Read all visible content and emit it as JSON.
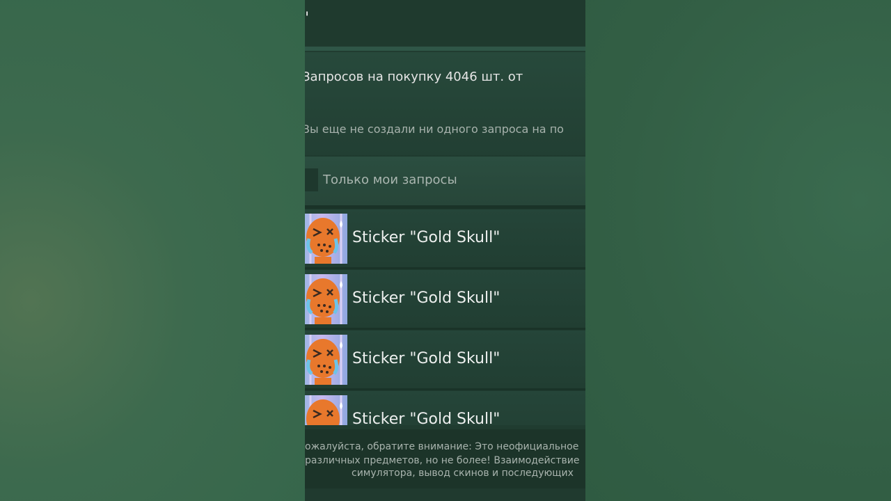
{
  "header": {
    "title": "\""
  },
  "requests": {
    "buy_text": "Запросов на покупку 4046 шт. от",
    "empty_text": "Вы еще не создали ни одного запроса на по"
  },
  "filter": {
    "label": "Только мои запросы",
    "checked": false
  },
  "items": [
    {
      "name": "Sticker \"Gold Skull\"",
      "icon": "sticker-crying-face-icon"
    },
    {
      "name": "Sticker \"Gold Skull\"",
      "icon": "sticker-crying-face-icon"
    },
    {
      "name": "Sticker \"Gold Skull\"",
      "icon": "sticker-crying-face-icon"
    },
    {
      "name": "Sticker \"Gold Skull\"",
      "icon": "sticker-crying-face-icon"
    }
  ],
  "footer": {
    "line1": "ожалуйста, обратите внимание: Это неофициальное",
    "line2": "различных предметов, но не более! Взаимодействие",
    "line3": "симулятора, вывод скинов и последующих"
  },
  "colors": {
    "accent_green": "#2f5f45",
    "panel": "#254539",
    "text": "#eef0ef"
  }
}
